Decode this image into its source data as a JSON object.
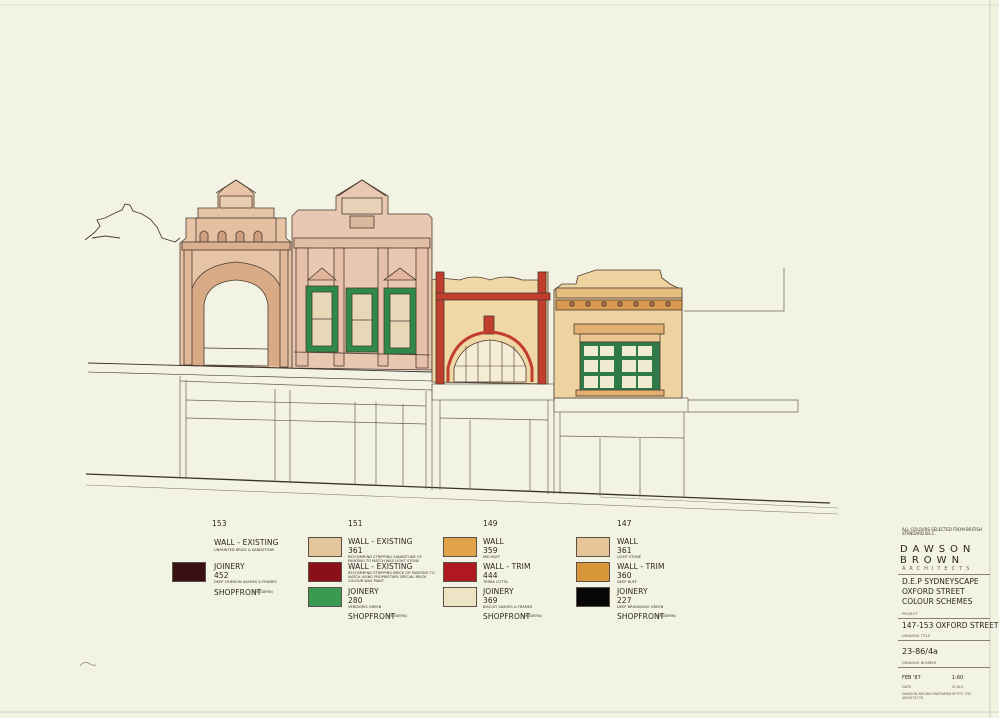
{
  "legend_note": "ALL COLOURS SELECTED FROM BRITISH STANDARD BS.C.",
  "firm": {
    "name": "DAWSON BROWN",
    "subtitle": "ARCHITECTS"
  },
  "project_title_lines": [
    "D.E.P SYDNEYSCAPE",
    "OXFORD STREET",
    "COLOUR SCHEMES"
  ],
  "project_label": "PROJECT",
  "project_address": "147-153 OXFORD STREET",
  "drawing_title_label": "DRAWING TITLE",
  "drawing_number": "23-86/4a",
  "drawing_number_label": "DRAWING NUMBER",
  "date": "FEB '87",
  "date_label": "DATE",
  "scale": "1:60",
  "scale_label": "SCALE",
  "firm_footer": "DAWSON BROWN PARTNERSHIP PTY. LTD. ARCHITECTS",
  "buildings": [
    {
      "number": "153",
      "items": [
        {
          "name": "WALL - EXISTING",
          "detail": "UNPAINTED BRICK & SANDSTONE",
          "color": ""
        },
        {
          "name": "JOINERY",
          "code": "452",
          "detail": "DEEP CRIMSON SASHES & FRAMES",
          "color": "#3a1014"
        },
        {
          "name": "SHOPFRONT",
          "detail": "(MODERN)",
          "color": ""
        }
      ]
    },
    {
      "number": "151",
      "items": [
        {
          "name": "WALL - EXISTING",
          "code": "361",
          "detail": "RECOMMEND STRIPPING SANDSTONE OF PAINTING TO MATCH WAS LIGHT STONE",
          "color": "#e2c69a"
        },
        {
          "name": "WALL - EXISTING",
          "detail": "RECOMMEND STRIPPING BRICK OR PAINTING TO MATCH USING PROPRIETARY SPECIAL BRICK COLOUR WAX PAINT",
          "color": "#8a1018"
        },
        {
          "name": "JOINERY",
          "code": "280",
          "detail": "VERDIGRIS GREEN",
          "color": "#3a9a52"
        },
        {
          "name": "SHOPFRONT",
          "detail": "(MODERN)",
          "color": ""
        }
      ]
    },
    {
      "number": "149",
      "items": [
        {
          "name": "WALL",
          "code": "359",
          "detail": "MID BUFF",
          "color": "#e2a24a"
        },
        {
          "name": "WALL - TRIM",
          "code": "444",
          "detail": "TERRA COTTA",
          "color": "#b01820"
        },
        {
          "name": "JOINERY",
          "code": "369",
          "detail": "BISCUIT SASHES & FRAMES",
          "color": "#ece4c4"
        },
        {
          "name": "SHOPFRONT",
          "detail": "(MODERN)",
          "color": ""
        }
      ]
    },
    {
      "number": "147",
      "items": [
        {
          "name": "WALL",
          "code": "361",
          "detail": "LIGHT STONE",
          "color": "#e6c498"
        },
        {
          "name": "WALL - TRIM",
          "code": "360",
          "detail": "DEEP BUFF",
          "color": "#d8963a"
        },
        {
          "name": "JOINERY",
          "code": "227",
          "detail": "DEEP BRUNSWICK GREEN",
          "color": "#060606"
        },
        {
          "name": "SHOPFRONT",
          "detail": "(MODERN)",
          "color": ""
        }
      ]
    }
  ],
  "palette": {
    "b153_wall": "#e9c9a8",
    "b151_wall": "#e8c8b0",
    "b149_wall": "#f0d8a8",
    "b149_trim": "#c03a2a",
    "b147_wall": "#eed5a0",
    "green": "#2e8a4a",
    "ink": "#4a3a30"
  }
}
